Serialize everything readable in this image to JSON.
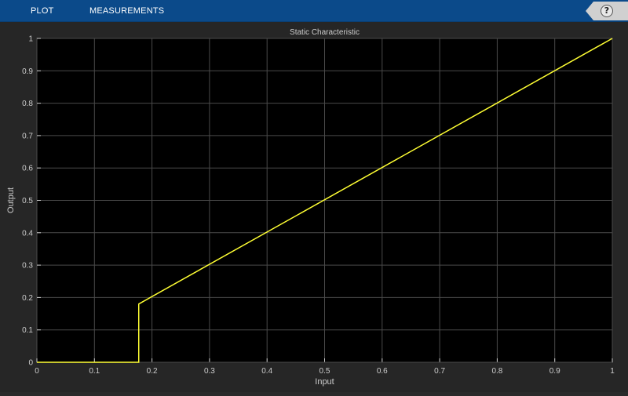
{
  "toolstrip": {
    "tabs": [
      {
        "label": "PLOT"
      },
      {
        "label": "MEASUREMENTS"
      }
    ],
    "help_glyph": "?"
  },
  "colors": {
    "toolstrip_bg": "#0b4a8a",
    "figure_bg": "#262626",
    "axes_bg": "#000000",
    "grid": "#4a4a4a",
    "text": "#cccccc",
    "line": "#ffff33"
  },
  "chart_data": {
    "type": "line",
    "title": "Static Characteristic",
    "xlabel": "Input",
    "ylabel": "Output",
    "xlim": [
      0,
      1
    ],
    "ylim": [
      0,
      1
    ],
    "grid": true,
    "xticks": [
      0,
      0.1,
      0.2,
      0.3,
      0.4,
      0.5,
      0.6,
      0.7,
      0.8,
      0.9,
      1
    ],
    "yticks": [
      0,
      0.1,
      0.2,
      0.3,
      0.4,
      0.5,
      0.6,
      0.7,
      0.8,
      0.9,
      1
    ],
    "series": [
      {
        "x": [
          0,
          0.177,
          0.177,
          1
        ],
        "y": [
          0,
          0,
          0.18,
          1
        ]
      }
    ]
  }
}
